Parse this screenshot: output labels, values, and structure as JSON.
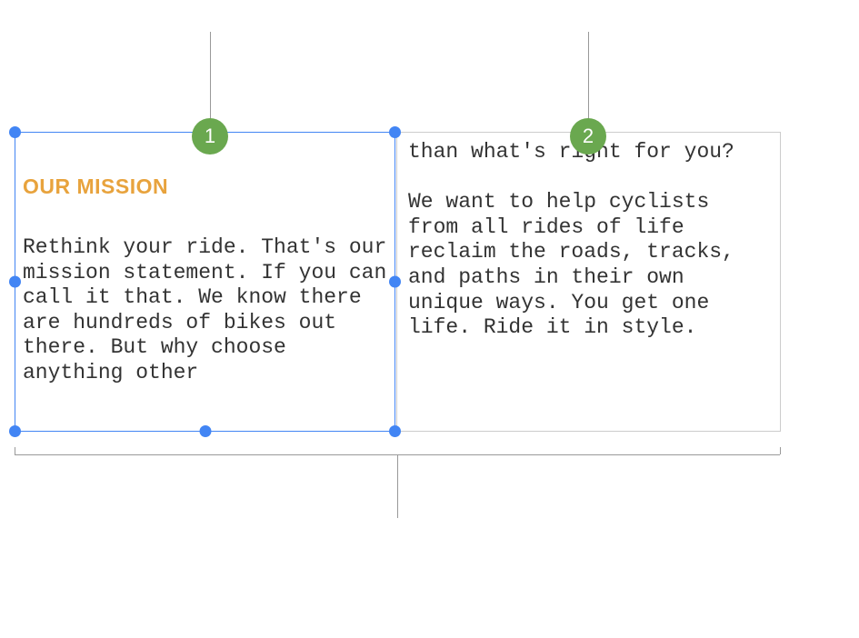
{
  "callouts": {
    "badge1": "1",
    "badge2": "2"
  },
  "textbox1": {
    "heading": "OUR MISSION",
    "body": "Rethink your ride. That's our mission statement. If you can call it that. We know there are hundreds of bikes out there. But why choose anything other"
  },
  "textbox2": {
    "body": "than what's right for you?\n\nWe want to help cyclists from all rides of life reclaim the roads, tracks, and paths in their own unique ways. You get one life. Ride it in style."
  },
  "colors": {
    "accent_heading": "#e8a33d",
    "selection_border": "#4285f4",
    "badge_bg": "#6aa84f"
  }
}
